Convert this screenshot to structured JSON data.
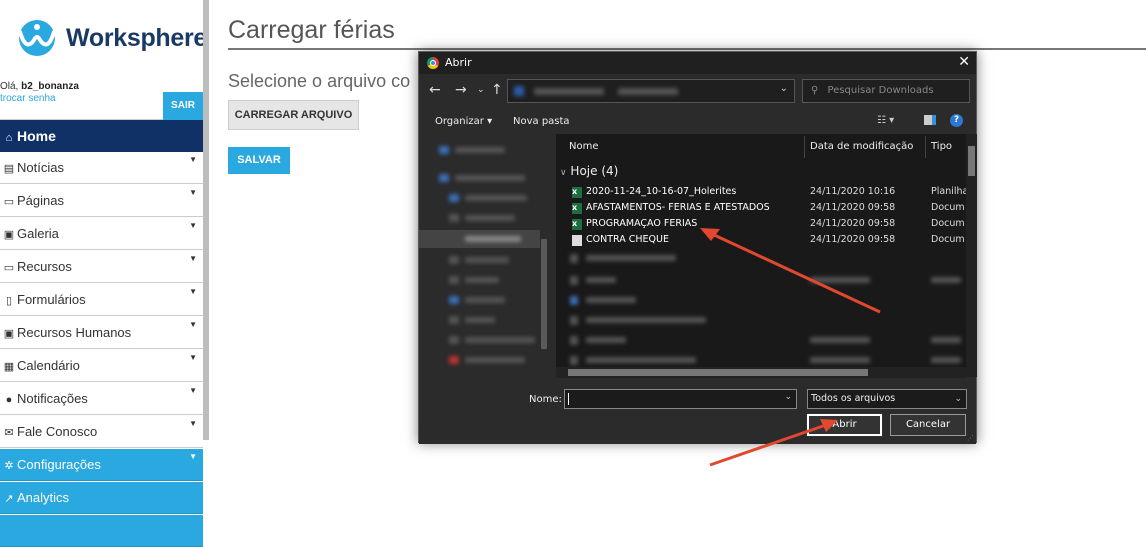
{
  "brand": {
    "name": "Worksphere",
    "colors": {
      "navy": "#0f3166",
      "accent": "#2aa9e0"
    }
  },
  "user": {
    "greeting": "Olá,",
    "username": "b2_bonanza",
    "change_password": "trocar senha",
    "logout": "SAIR"
  },
  "sidebar": {
    "home": {
      "icon": "home-icon",
      "label": "Home"
    },
    "items": [
      {
        "icon": "newspaper-icon",
        "label": "Notícias",
        "has_submenu": true
      },
      {
        "icon": "window-icon",
        "label": "Páginas",
        "has_submenu": true
      },
      {
        "icon": "image-icon",
        "label": "Galeria",
        "has_submenu": true
      },
      {
        "icon": "laptop-icon",
        "label": "Recursos",
        "has_submenu": true
      },
      {
        "icon": "file-icon",
        "label": "Formulários",
        "has_submenu": true
      },
      {
        "icon": "id-card-icon",
        "label": "Recursos Humanos",
        "has_submenu": true
      },
      {
        "icon": "calendar-icon",
        "label": "Calendário",
        "has_submenu": true
      },
      {
        "icon": "info-icon",
        "label": "Notificações",
        "has_submenu": true
      },
      {
        "icon": "envelope-icon",
        "label": "Fale Conosco",
        "has_submenu": true
      }
    ],
    "admin_items": [
      {
        "icon": "gear-icon",
        "label": "Configurações",
        "has_submenu": true
      },
      {
        "icon": "chart-line-icon",
        "label": "Analytics",
        "has_submenu": false
      }
    ]
  },
  "main": {
    "title": "Carregar férias",
    "subtitle": "Selecione o arquivo co",
    "upload_button": "CARREGAR ARQUIVO",
    "save_button": "SALVAR"
  },
  "dialog": {
    "title": "Abrir",
    "search_placeholder": "Pesquisar Downloads",
    "toolbar": {
      "organize": "Organizar ▾",
      "new_folder": "Nova pasta"
    },
    "columns": {
      "name": "Nome",
      "modified": "Data de modificação",
      "type": "Tipo"
    },
    "group": "Hoje (4)",
    "files": [
      {
        "name": "2020-11-24_10-16-07_Holerites",
        "modified": "24/11/2020 10:16",
        "type": "Planilha",
        "icon": "excel-icon"
      },
      {
        "name": "AFASTAMENTOS- FERIAS E ATESTADOS",
        "modified": "24/11/2020 09:58",
        "type": "Docum",
        "icon": "excel-icon"
      },
      {
        "name": "PROGRAMAÇAO FERIAS",
        "modified": "24/11/2020 09:58",
        "type": "Docum",
        "icon": "excel-icon"
      },
      {
        "name": "CONTRA CHEQUE",
        "modified": "24/11/2020 09:58",
        "type": "Docum",
        "icon": "document-icon"
      }
    ],
    "filename_label": "Nome:",
    "filename_value": "",
    "filter": "Todos os arquivos",
    "open_button": "Abrir",
    "cancel_button": "Cancelar"
  }
}
